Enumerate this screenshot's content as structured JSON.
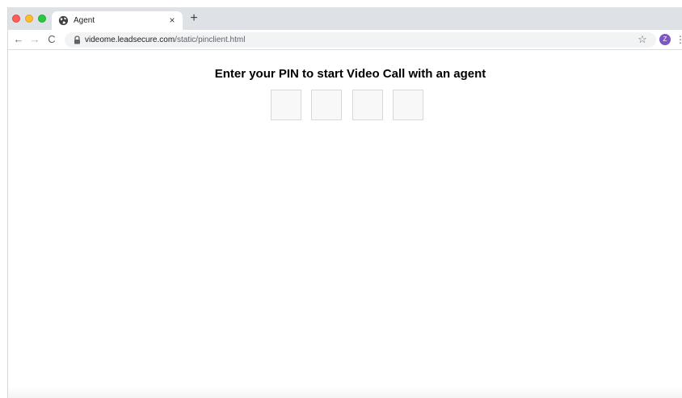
{
  "browser": {
    "tab": {
      "title": "Agent",
      "favicon": "globe-icon",
      "close_glyph": "×"
    },
    "new_tab_glyph": "+",
    "nav": {
      "back_glyph": "←",
      "forward_glyph": "→",
      "reload_glyph": "C"
    },
    "address_bar": {
      "host": "videome.leadsecure.com",
      "path": "/static/pinclient.html",
      "lock_icon": "lock-icon"
    },
    "bookmark_glyph": "☆",
    "profile_initial": "Z",
    "profile_color": "#7e57c2",
    "menu_glyph": "⋮"
  },
  "page": {
    "heading": "Enter your PIN to start Video Call with an agent",
    "pin_inputs": [
      "",
      "",
      "",
      ""
    ]
  }
}
